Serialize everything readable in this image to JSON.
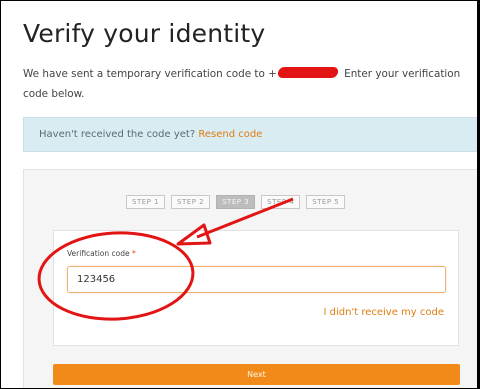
{
  "page": {
    "title": "Verify your identity",
    "description_prefix": "We have sent a temporary verification code to +",
    "description_suffix": " Enter your verification code below.",
    "info_text": "Haven't received the code yet?",
    "resend_label": "Resend code"
  },
  "steps": [
    {
      "label": "STEP 1"
    },
    {
      "label": "STEP 2"
    },
    {
      "label": "STEP 3",
      "active": true
    },
    {
      "label": "STEP 4"
    },
    {
      "label": "STEP 5"
    }
  ],
  "form": {
    "field_label": "Verification code",
    "required_marker": "*",
    "code_value": "123456",
    "no_code_link": "I didn't receive my code",
    "next_label": "Next"
  },
  "colors": {
    "accent": "#f28a1a",
    "link": "#e07d10",
    "info_bg": "#d9ecf2",
    "annotation": "#e21414"
  }
}
